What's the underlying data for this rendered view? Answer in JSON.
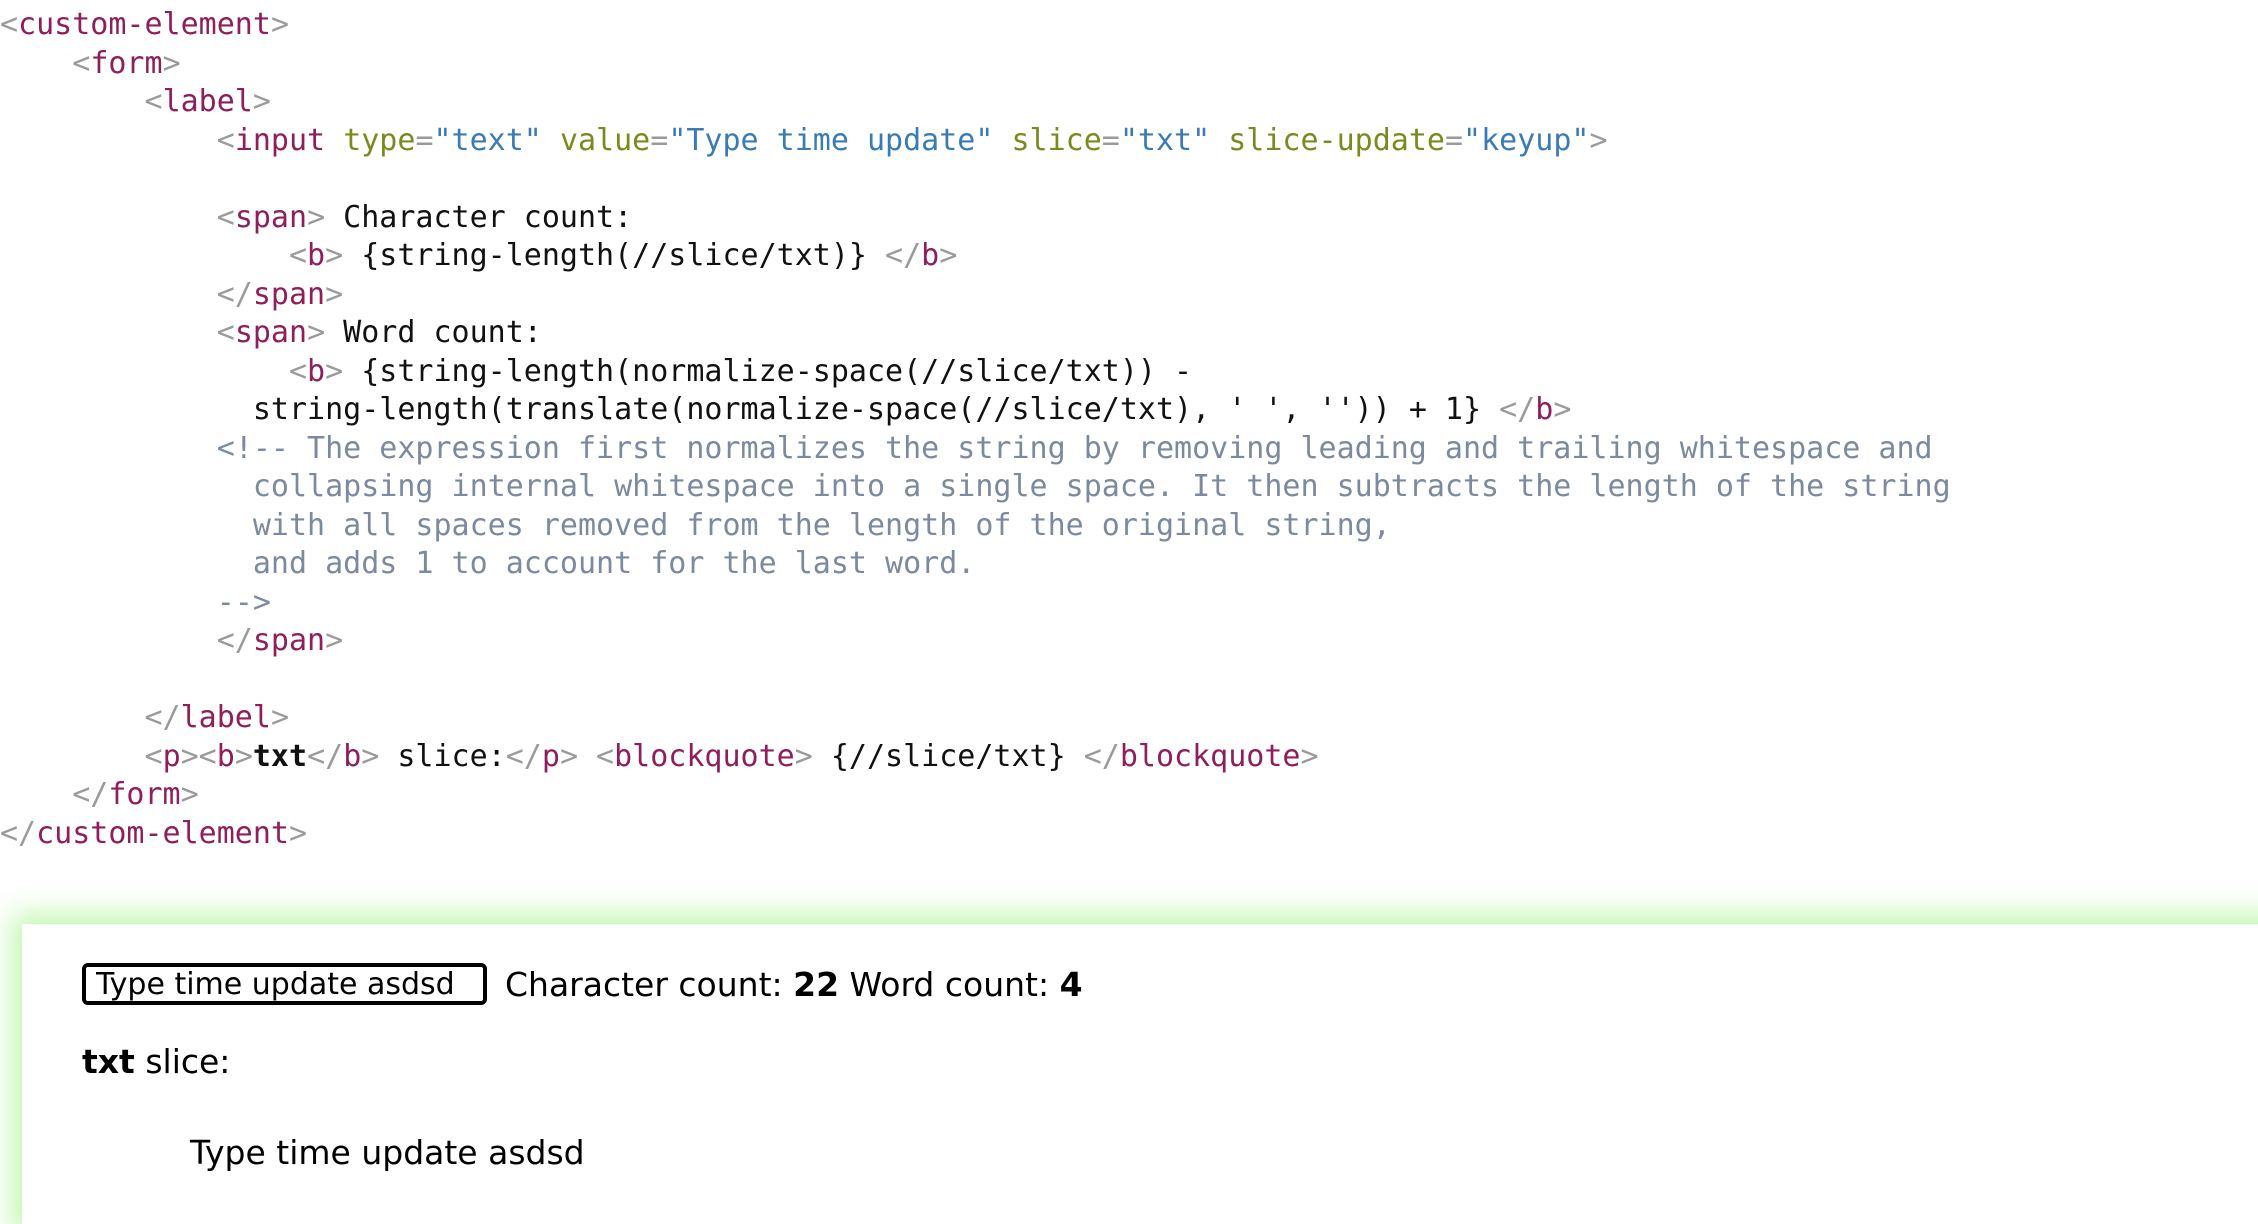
{
  "code": {
    "language": "html",
    "colors": {
      "bracket": "#9a9a9a",
      "tag": "#8f1f5a",
      "attribute": "#7a8b1e",
      "string": "#3a7bb5",
      "text": "#111111",
      "comment": "#7b8a9e"
    },
    "lines": [
      {
        "indent": 0,
        "segments": [
          {
            "cls": "br",
            "t": "<"
          },
          {
            "cls": "tag",
            "t": "custom-element"
          },
          {
            "cls": "br",
            "t": ">"
          }
        ]
      },
      {
        "indent": 1,
        "segments": [
          {
            "cls": "br",
            "t": "<"
          },
          {
            "cls": "tag",
            "t": "form"
          },
          {
            "cls": "br",
            "t": ">"
          }
        ]
      },
      {
        "indent": 2,
        "segments": [
          {
            "cls": "br",
            "t": "<"
          },
          {
            "cls": "tag",
            "t": "label"
          },
          {
            "cls": "br",
            "t": ">"
          }
        ]
      },
      {
        "indent": 3,
        "segments": [
          {
            "cls": "br",
            "t": "<"
          },
          {
            "cls": "tag",
            "t": "input"
          },
          {
            "cls": "txt",
            "t": " "
          },
          {
            "cls": "attr",
            "t": "type"
          },
          {
            "cls": "eq",
            "t": "="
          },
          {
            "cls": "str",
            "t": "\"text\""
          },
          {
            "cls": "txt",
            "t": " "
          },
          {
            "cls": "attr",
            "t": "value"
          },
          {
            "cls": "eq",
            "t": "="
          },
          {
            "cls": "str",
            "t": "\"Type time update\""
          },
          {
            "cls": "txt",
            "t": " "
          },
          {
            "cls": "attr",
            "t": "slice"
          },
          {
            "cls": "eq",
            "t": "="
          },
          {
            "cls": "str",
            "t": "\"txt\""
          },
          {
            "cls": "txt",
            "t": " "
          },
          {
            "cls": "attr",
            "t": "slice-update"
          },
          {
            "cls": "eq",
            "t": "="
          },
          {
            "cls": "str",
            "t": "\"keyup\""
          },
          {
            "cls": "br",
            "t": ">"
          }
        ]
      },
      {
        "indent": 0,
        "blank": true,
        "segments": []
      },
      {
        "indent": 3,
        "segments": [
          {
            "cls": "br",
            "t": "<"
          },
          {
            "cls": "tag",
            "t": "span"
          },
          {
            "cls": "br",
            "t": ">"
          },
          {
            "cls": "txt",
            "t": " Character count:"
          }
        ]
      },
      {
        "indent": 4,
        "segments": [
          {
            "cls": "br",
            "t": "<"
          },
          {
            "cls": "tag",
            "t": "b"
          },
          {
            "cls": "br",
            "t": ">"
          },
          {
            "cls": "txt",
            "t": " {string-length(//slice/txt)} "
          },
          {
            "cls": "br",
            "t": "</"
          },
          {
            "cls": "tag",
            "t": "b"
          },
          {
            "cls": "br",
            "t": ">"
          }
        ]
      },
      {
        "indent": 3,
        "segments": [
          {
            "cls": "br",
            "t": "</"
          },
          {
            "cls": "tag",
            "t": "span"
          },
          {
            "cls": "br",
            "t": ">"
          }
        ]
      },
      {
        "indent": 3,
        "segments": [
          {
            "cls": "br",
            "t": "<"
          },
          {
            "cls": "tag",
            "t": "span"
          },
          {
            "cls": "br",
            "t": ">"
          },
          {
            "cls": "txt",
            "t": " Word count:"
          }
        ]
      },
      {
        "indent": 4,
        "segments": [
          {
            "cls": "br",
            "t": "<"
          },
          {
            "cls": "tag",
            "t": "b"
          },
          {
            "cls": "br",
            "t": ">"
          },
          {
            "cls": "txt",
            "t": " {string-length(normalize-space(//slice/txt)) -"
          }
        ]
      },
      {
        "indent": 0,
        "raw_pad": 14,
        "segments": [
          {
            "cls": "txt",
            "t": "string-length(translate(normalize-space(//slice/txt), ' ', '')) + 1} "
          },
          {
            "cls": "br",
            "t": "</"
          },
          {
            "cls": "tag",
            "t": "b"
          },
          {
            "cls": "br",
            "t": ">"
          }
        ]
      },
      {
        "indent": 0,
        "raw_pad": 12,
        "segments": [
          {
            "cls": "cmt",
            "t": "<!-- The expression first normalizes the string by removing leading and trailing whitespace and"
          }
        ]
      },
      {
        "indent": 0,
        "raw_pad": 14,
        "segments": [
          {
            "cls": "cmt",
            "t": "collapsing internal whitespace into a single space. It then subtracts the length of the string"
          }
        ]
      },
      {
        "indent": 0,
        "raw_pad": 14,
        "segments": [
          {
            "cls": "cmt",
            "t": "with all spaces removed from the length of the original string,"
          }
        ]
      },
      {
        "indent": 0,
        "raw_pad": 14,
        "segments": [
          {
            "cls": "cmt",
            "t": "and adds 1 to account for the last word."
          }
        ]
      },
      {
        "indent": 0,
        "raw_pad": 12,
        "segments": [
          {
            "cls": "cmt",
            "t": "-->"
          }
        ]
      },
      {
        "indent": 3,
        "segments": [
          {
            "cls": "br",
            "t": "</"
          },
          {
            "cls": "tag",
            "t": "span"
          },
          {
            "cls": "br",
            "t": ">"
          }
        ]
      },
      {
        "indent": 0,
        "blank": true,
        "segments": []
      },
      {
        "indent": 2,
        "segments": [
          {
            "cls": "br",
            "t": "</"
          },
          {
            "cls": "tag",
            "t": "label"
          },
          {
            "cls": "br",
            "t": ">"
          }
        ]
      },
      {
        "indent": 2,
        "segments": [
          {
            "cls": "br",
            "t": "<"
          },
          {
            "cls": "tag",
            "t": "p"
          },
          {
            "cls": "br",
            "t": "><"
          },
          {
            "cls": "tag",
            "t": "b"
          },
          {
            "cls": "br",
            "t": ">"
          },
          {
            "cls": "bold",
            "t": "txt"
          },
          {
            "cls": "br",
            "t": "</"
          },
          {
            "cls": "tag",
            "t": "b"
          },
          {
            "cls": "br",
            "t": ">"
          },
          {
            "cls": "txt",
            "t": " slice:"
          },
          {
            "cls": "br",
            "t": "</"
          },
          {
            "cls": "tag",
            "t": "p"
          },
          {
            "cls": "br",
            "t": "> <"
          },
          {
            "cls": "tag",
            "t": "blockquote"
          },
          {
            "cls": "br",
            "t": ">"
          },
          {
            "cls": "txt",
            "t": " {//slice/txt} "
          },
          {
            "cls": "br",
            "t": "</"
          },
          {
            "cls": "tag",
            "t": "blockquote"
          },
          {
            "cls": "br",
            "t": ">"
          }
        ]
      },
      {
        "indent": 1,
        "segments": [
          {
            "cls": "br",
            "t": "</"
          },
          {
            "cls": "tag",
            "t": "form"
          },
          {
            "cls": "br",
            "t": ">"
          }
        ]
      },
      {
        "indent": 0,
        "segments": [
          {
            "cls": "br",
            "t": "</"
          },
          {
            "cls": "tag",
            "t": "custom-element"
          },
          {
            "cls": "br",
            "t": ">"
          }
        ]
      }
    ]
  },
  "result": {
    "glow_color": "#78f050",
    "input": {
      "value": "Type time update asdsd",
      "placeholder": "Type time update"
    },
    "character_count_label": "Character count: ",
    "character_count_value": "22",
    "word_count_label": " Word count: ",
    "word_count_value": "4",
    "slice_name": "txt",
    "slice_label": " slice:",
    "blockquote_value": "Type time update asdsd"
  }
}
